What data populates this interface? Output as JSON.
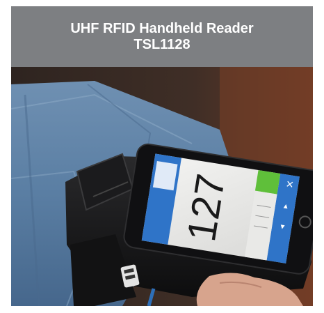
{
  "header": {
    "title_line1": "UHF RFID Handheld Reader",
    "title_line2": "TSL1128"
  },
  "photo": {
    "screen_readout": "127",
    "subject": "handheld-rfid-reader-with-smartphone"
  },
  "colors": {
    "title_bar": "#7d7f82",
    "title_text": "#ffffff",
    "screen_blue": "#2f74c8",
    "button_green": "#5fbf3a",
    "denim": "#5a7fa3"
  }
}
